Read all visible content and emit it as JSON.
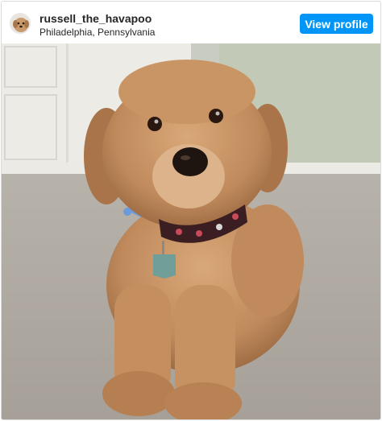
{
  "post": {
    "username": "russell_the_havapoo",
    "location": "Philadelphia, Pennsylvania",
    "view_profile_label": "View profile",
    "accent_color": "#0095f6"
  },
  "icons": {
    "avatar": "dog-avatar",
    "photo": "dog-photo"
  }
}
